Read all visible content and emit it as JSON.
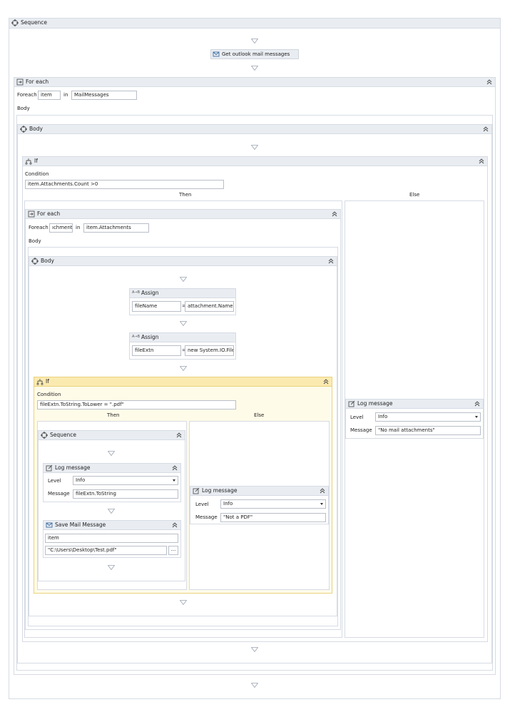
{
  "sequence": {
    "title": "Sequence"
  },
  "get_outlook": {
    "label": "Get outlook mail messages"
  },
  "foreach_outer": {
    "title": "For each",
    "foreach_label": "Foreach",
    "item": "item",
    "in_label": "in",
    "collection": "MailMessages",
    "body_label": "Body"
  },
  "body_outer": {
    "title": "Body"
  },
  "if_outer": {
    "title": "If",
    "condition_label": "Condition",
    "condition": "item.Attachments.Count >0",
    "then_label": "Then",
    "else_label": "Else"
  },
  "foreach_inner": {
    "title": "For each",
    "foreach_label": "Foreach",
    "item": "ıchment",
    "in_label": "in",
    "collection": "item.Attachments",
    "body_label": "Body"
  },
  "body_inner": {
    "title": "Body"
  },
  "assign1": {
    "title": "Assign",
    "to": "fileName",
    "eq": "=",
    "value": "attachment.Name"
  },
  "assign2": {
    "title": "Assign",
    "to": "fileExtn",
    "eq": "=",
    "value": "new System.IO.File"
  },
  "if_inner": {
    "title": "If",
    "condition_label": "Condition",
    "condition": "fileExtn.ToString.ToLower = \".pdf\"",
    "then_label": "Then",
    "else_label": "Else"
  },
  "seq_inner": {
    "title": "Sequence"
  },
  "log1": {
    "title": "Log message",
    "level_label": "Level",
    "level": "Info",
    "message_label": "Message",
    "message": "fileExtn.ToString"
  },
  "save_mail": {
    "title": "Save Mail Message",
    "mail": "item",
    "path": "\"C:\\Users\\Desktop\\Test.pdf\"",
    "browse": "..."
  },
  "log2": {
    "title": "Log message",
    "level_label": "Level",
    "level": "Info",
    "message_label": "Message",
    "message": "\"Not a PDF\""
  },
  "log3": {
    "title": "Log message",
    "level_label": "Level",
    "level": "Info",
    "message_label": "Message",
    "message": "\"No mail attachments\""
  },
  "icons": [
    "sequence-icon",
    "mail-icon",
    "foreach-icon",
    "if-icon",
    "assign-icon",
    "log-icon",
    "collapse-icon",
    "drop-target-icon"
  ]
}
